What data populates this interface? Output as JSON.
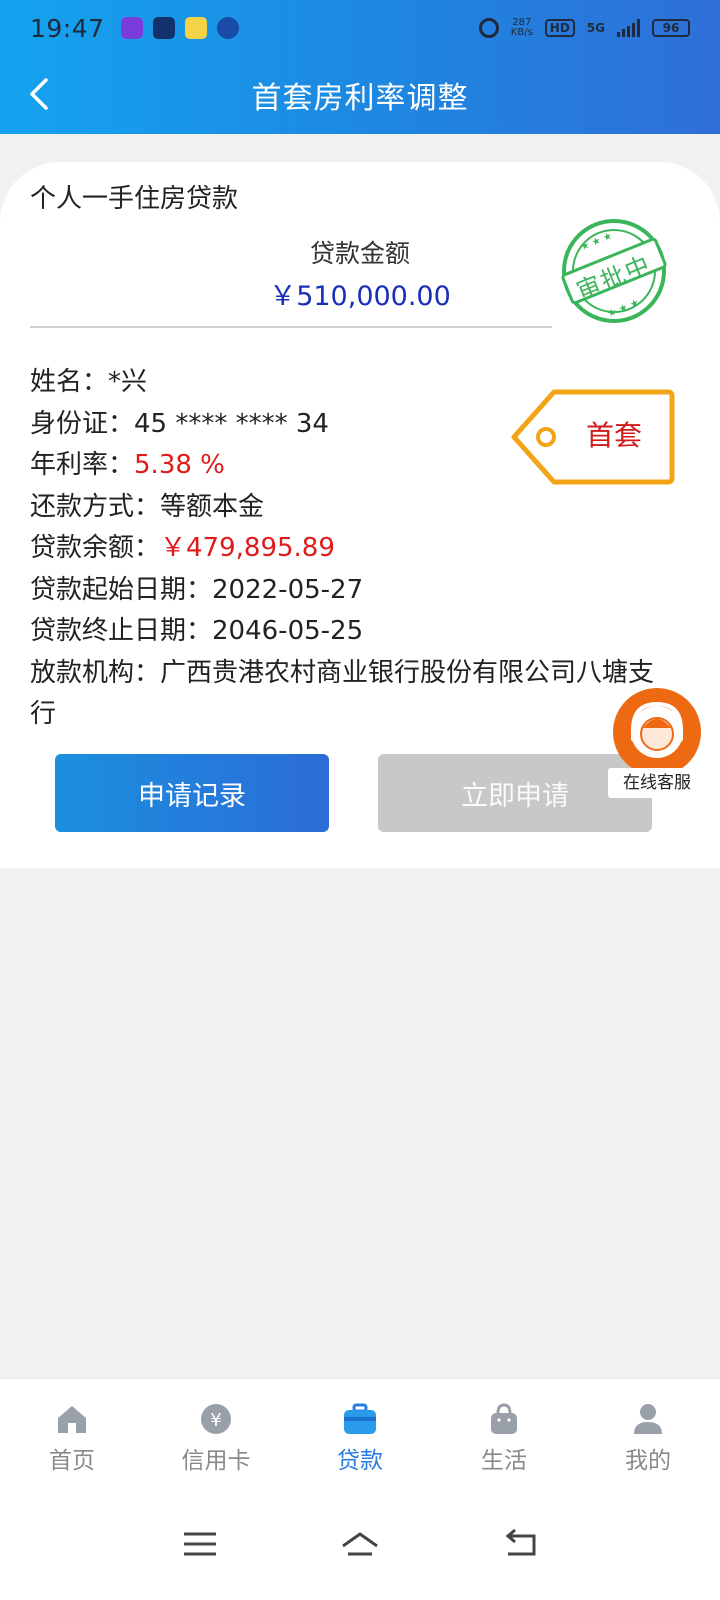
{
  "status_bar": {
    "time": "19:47",
    "speed_top": "287",
    "speed_bottom": "KB/s",
    "hd": "HD",
    "network": "5G",
    "battery": "96"
  },
  "header": {
    "title": "首套房利率调整"
  },
  "loan_card": {
    "loan_type": "个人一手住房贷款",
    "amount_label": "贷款金额",
    "amount_value": "￥510,000.00",
    "stamp_text": "审批中",
    "tag_label": "首套",
    "fields": [
      {
        "label": "姓名：",
        "value": "*兴"
      },
      {
        "label": "身份证：",
        "value": "45 **** **** 34"
      },
      {
        "label": "年利率：",
        "value": "5.38 %"
      },
      {
        "label": "还款方式：",
        "value": "等额本金"
      },
      {
        "label": "贷款余额：",
        "value": "￥479,895.89"
      },
      {
        "label": "贷款起始日期：",
        "value": "2022-05-27"
      },
      {
        "label": "贷款终止日期：",
        "value": "2046-05-25"
      },
      {
        "label": "放款机构：",
        "value": "广西贵港农村商业银行股份有限公司八塘支行"
      }
    ],
    "records_button": "申请记录",
    "apply_button": "立即申请"
  },
  "customer_service": {
    "label": "在线客服"
  },
  "bottom_nav": {
    "items": [
      {
        "label": "首页",
        "icon": "home-icon"
      },
      {
        "label": "信用卡",
        "icon": "yuan-coin-icon"
      },
      {
        "label": "贷款",
        "icon": "briefcase-icon",
        "active": true
      },
      {
        "label": "生活",
        "icon": "shopping-bag-icon"
      },
      {
        "label": "我的",
        "icon": "user-icon"
      }
    ]
  },
  "colors": {
    "header_gradient_start": "#14a3ee",
    "header_gradient_end": "#2f6fd8",
    "amount_blue": "#1a2fb8",
    "highlight_red": "#e01b1b",
    "stamp_green": "#3bb55a",
    "tag_orange": "#f3a316",
    "active_nav": "#2a7de0"
  }
}
